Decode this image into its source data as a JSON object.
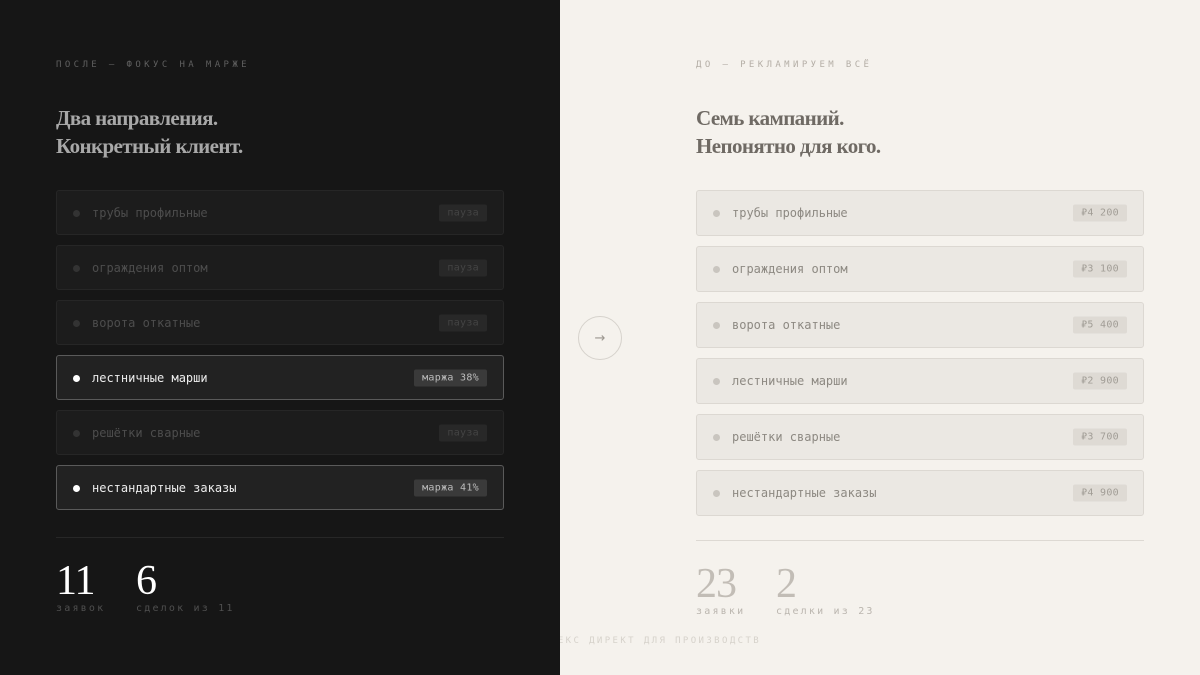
{
  "after": {
    "eyebrow": "ПОСЛЕ — ФОКУС НА МАРЖЕ",
    "headline": [
      "Два направления.",
      "Конкретный клиент."
    ],
    "items": [
      {
        "label": "трубы профильные",
        "tag": "пауза",
        "active": false
      },
      {
        "label": "ограждения оптом",
        "tag": "пауза",
        "active": false
      },
      {
        "label": "ворота откатные",
        "tag": "пауза",
        "active": false
      },
      {
        "label": "лестничные марши",
        "tag": "маржа 38%",
        "active": true
      },
      {
        "label": "решётки сварные",
        "tag": "пауза",
        "active": false
      },
      {
        "label": "нестандартные заказы",
        "tag": "маржа 41%",
        "active": true
      }
    ],
    "stats": [
      {
        "value": "11",
        "label": "заявок"
      },
      {
        "value": "6",
        "label": "сделок из 11"
      }
    ]
  },
  "before": {
    "eyebrow": "ДО — РЕКЛАМИРУЕМ ВСЁ",
    "headline": [
      "Семь кампаний.",
      "Непонятно для кого."
    ],
    "items": [
      {
        "label": "трубы профильные",
        "tag": "₽4 200"
      },
      {
        "label": "ограждения оптом",
        "tag": "₽3 100"
      },
      {
        "label": "ворота откатные",
        "tag": "₽5 400"
      },
      {
        "label": "лестничные марши",
        "tag": "₽2 900"
      },
      {
        "label": "решётки сварные",
        "tag": "₽3 700"
      },
      {
        "label": "нестандартные заказы",
        "tag": "₽4 900"
      }
    ],
    "stats": [
      {
        "value": "23",
        "label": "заявки"
      },
      {
        "value": "2",
        "label": "сделки из 23"
      }
    ]
  },
  "arrow": {
    "icon": "arrow-right-icon",
    "glyph": "→"
  },
  "footer": "ДЕКС ДИРЕКТ ДЛЯ ПРОИЗВОДСТВ"
}
